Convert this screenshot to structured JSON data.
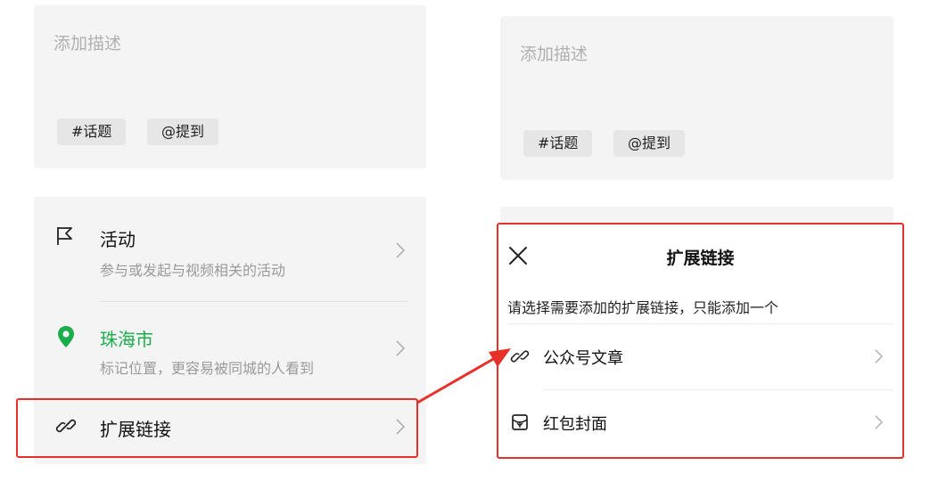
{
  "left": {
    "description_placeholder": "添加描述",
    "chips": [
      "#话题",
      "@提到"
    ],
    "activity": {
      "title": "活动",
      "subtitle": "参与或发起与视频相关的活动"
    },
    "location": {
      "title": "珠海市",
      "subtitle": "标记位置，更容易被同城的人看到"
    },
    "extend_link": {
      "title": "扩展链接"
    }
  },
  "right": {
    "description_placeholder": "添加描述",
    "chips": [
      "#话题",
      "@提到"
    ],
    "sheet": {
      "title": "扩展链接",
      "hint": "请选择需要添加的扩展链接，只能添加一个",
      "options": [
        "公众号文章",
        "红包封面"
      ]
    }
  },
  "colors": {
    "location_green": "#1aad4c",
    "annotation_red": "#e8302a"
  },
  "icons": {
    "activity": "flag-icon",
    "location": "location-pin-icon",
    "extend_link": "link-icon",
    "close": "close-icon",
    "article": "link-icon",
    "red_packet": "red-packet-cover-icon",
    "chevron": "chevron-right-icon"
  }
}
